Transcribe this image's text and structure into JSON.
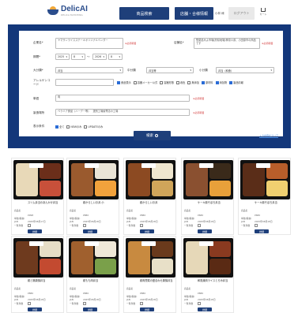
{
  "header": {
    "logo_name": "DelicAI",
    "logo_sub": "DELICA MATCHING",
    "nav_product_search": "商品検索",
    "nav_store_info": "店舗・合様情報",
    "user_name": "小林 様",
    "logout": "ログアウト",
    "cart_label": "カート"
  },
  "search": {
    "product_name_label": "企業名*",
    "product_name_value": "ヤマサンライスステーキオリジナルベンダー",
    "product_name_req": "※必須項目",
    "store_label": "店舗名*",
    "store_value": "惣菜処みよ市場(府県地場)神奈川県、小田原市の商品です",
    "store_req": "※必須項目",
    "period_label": "期間*",
    "period_year_from": "2025",
    "period_month_from": "8",
    "period_sep": "〜",
    "period_year_to": "2026",
    "period_month_to": "8",
    "category_label": "大分類*",
    "category_value": "弁当",
    "mid_label": "中分類",
    "mid_value": "弁当等",
    "small_label": "小分類",
    "small_value": "弁当（和食）",
    "allergy_label": "アレルゲンコード",
    "checks": [
      {
        "label": "食品表示",
        "on": true
      },
      {
        "label": "容器メーカー公式",
        "on": false
      },
      {
        "label": "容器形態",
        "on": false
      },
      {
        "label": "着色",
        "on": false
      },
      {
        "label": "無添加",
        "on": false
      },
      {
        "label": "原材料",
        "on": true
      },
      {
        "label": "添加物",
        "on": true
      },
      {
        "label": "製品情報",
        "on": true
      }
    ],
    "keyword_label": "単語",
    "keyword_value": "肉",
    "keyword_req": "※必須項目",
    "area_label": "製造場所",
    "area_value": "ベラミア食品（ハーデー等）",
    "area_note": "選別工場最寄店の工場",
    "area_req": "※必須項目",
    "display_label": "表示条件",
    "display_opts": [
      {
        "label": "全て",
        "on": true
      },
      {
        "label": "NEWのみ",
        "on": false
      },
      {
        "label": "UPDATEのみ",
        "on": false
      }
    ],
    "search_button": "検索",
    "clear_link": "入力内容をクリア"
  },
  "product_meta_labels": {
    "price": "商品名",
    "maker": "単価(税抜)",
    "jan": "JAN",
    "date": "出荷日",
    "flag": "一覧件数",
    "detail": "詳細"
  },
  "products": [
    {
      "name": "スリム弁当のあんかけ弁当",
      "price": "¥998",
      "date": "2025年08月17日"
    },
    {
      "name": "鶏からしいお弁 小",
      "price": "¥880",
      "date": "2025年08月18日"
    },
    {
      "name": "鶏からしいお弁",
      "price": "¥880",
      "date": "2025年08月18日"
    },
    {
      "name": "ケーキ鶏そぼろ弁当",
      "price": "¥680",
      "date": "2025年08月18日"
    },
    {
      "name": "ケーキ鶏そぼろ弁当",
      "price": "¥680",
      "date": "2025年08月18日"
    },
    {
      "name": "鶏と豚唐揚弁当",
      "price": "¥880",
      "date": "2025年08月18日"
    },
    {
      "name": "鶏もも肉弁当",
      "price": "¥880",
      "date": "2025年08月18日"
    },
    {
      "name": "鶏肉惣菜の盛合わせ唐揚弁当",
      "price": "¥880",
      "date": "2025年08月18日"
    },
    {
      "name": "和風焼肉ライスとろみ弁当",
      "price": "¥880",
      "date": "2025年08月18日"
    }
  ],
  "colors": {
    "navy": "#13377a",
    "button": "#1e3f7a",
    "check_on": "#2b6cd6",
    "required": "#d03030"
  }
}
